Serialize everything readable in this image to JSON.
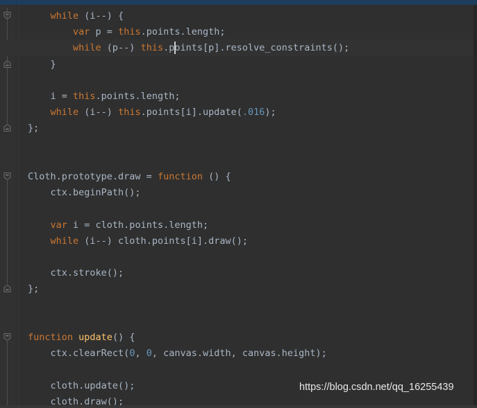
{
  "window": {
    "theme_background": "#2f2f2f",
    "gutter_background": "#313131",
    "titlebar_color": "#1e3d5c",
    "current_line_color": "#323232",
    "keyword_color": "#cc7832",
    "function_color": "#ffc66d",
    "number_color": "#6897bb",
    "text_color": "#a9b7c6",
    "caret_color": "#d0d0d0"
  },
  "watermark": {
    "text": "https://blog.csdn.net/qq_16255439"
  },
  "editor": {
    "language": "JavaScript",
    "caret": {
      "line": 3,
      "column": 26
    },
    "lines": [
      {
        "n": 1,
        "indent": 1,
        "current": false,
        "fold": "start",
        "tokens": [
          {
            "t": "while",
            "c": "kw"
          },
          {
            "t": " (i--) {",
            "c": "plain"
          }
        ]
      },
      {
        "n": 2,
        "indent": 2,
        "current": false,
        "fold": "none",
        "tokens": [
          {
            "t": "var",
            "c": "kw"
          },
          {
            "t": " p = ",
            "c": "plain"
          },
          {
            "t": "this",
            "c": "kw"
          },
          {
            "t": ".points.length;",
            "c": "plain"
          }
        ]
      },
      {
        "n": 3,
        "indent": 2,
        "current": true,
        "fold": "none",
        "tokens": [
          {
            "t": "while",
            "c": "kw"
          },
          {
            "t": " (p--) ",
            "c": "plain"
          },
          {
            "t": "this",
            "c": "kw"
          },
          {
            "t": ".points[p].resolve_constraints();",
            "c": "plain"
          }
        ]
      },
      {
        "n": 4,
        "indent": 1,
        "current": false,
        "fold": "end",
        "tokens": [
          {
            "t": "}",
            "c": "plain"
          }
        ]
      },
      {
        "n": 5,
        "indent": 0,
        "current": false,
        "fold": "none",
        "tokens": []
      },
      {
        "n": 6,
        "indent": 1,
        "current": false,
        "fold": "none",
        "tokens": [
          {
            "t": "i = ",
            "c": "plain"
          },
          {
            "t": "this",
            "c": "kw"
          },
          {
            "t": ".points.length;",
            "c": "plain"
          }
        ]
      },
      {
        "n": 7,
        "indent": 1,
        "current": false,
        "fold": "none",
        "tokens": [
          {
            "t": "while",
            "c": "kw"
          },
          {
            "t": " (i--) ",
            "c": "plain"
          },
          {
            "t": "this",
            "c": "kw"
          },
          {
            "t": ".points[i].update(",
            "c": "plain"
          },
          {
            "t": ".016",
            "c": "num"
          },
          {
            "t": ");",
            "c": "plain"
          }
        ]
      },
      {
        "n": 8,
        "indent": 0,
        "current": false,
        "fold": "end",
        "tokens": [
          {
            "t": "};",
            "c": "plain"
          }
        ]
      },
      {
        "n": 9,
        "indent": 0,
        "current": false,
        "fold": "none",
        "tokens": []
      },
      {
        "n": 10,
        "indent": 0,
        "current": false,
        "fold": "none",
        "tokens": []
      },
      {
        "n": 11,
        "indent": 0,
        "current": false,
        "fold": "start",
        "tokens": [
          {
            "t": "Cloth.prototype.draw = ",
            "c": "plain"
          },
          {
            "t": "function",
            "c": "kw"
          },
          {
            "t": " () {",
            "c": "plain"
          }
        ]
      },
      {
        "n": 12,
        "indent": 1,
        "current": false,
        "fold": "none",
        "tokens": [
          {
            "t": "ctx.beginPath();",
            "c": "plain"
          }
        ]
      },
      {
        "n": 13,
        "indent": 0,
        "current": false,
        "fold": "none",
        "tokens": []
      },
      {
        "n": 14,
        "indent": 1,
        "current": false,
        "fold": "none",
        "tokens": [
          {
            "t": "var",
            "c": "kw"
          },
          {
            "t": " i = cloth.points.length;",
            "c": "plain"
          }
        ]
      },
      {
        "n": 15,
        "indent": 1,
        "current": false,
        "fold": "none",
        "tokens": [
          {
            "t": "while",
            "c": "kw"
          },
          {
            "t": " (i--) cloth.points[i].draw();",
            "c": "plain"
          }
        ]
      },
      {
        "n": 16,
        "indent": 0,
        "current": false,
        "fold": "none",
        "tokens": []
      },
      {
        "n": 17,
        "indent": 1,
        "current": false,
        "fold": "none",
        "tokens": [
          {
            "t": "ctx.stroke();",
            "c": "plain"
          }
        ]
      },
      {
        "n": 18,
        "indent": 0,
        "current": false,
        "fold": "end",
        "tokens": [
          {
            "t": "};",
            "c": "plain"
          }
        ]
      },
      {
        "n": 19,
        "indent": 0,
        "current": false,
        "fold": "none",
        "tokens": []
      },
      {
        "n": 20,
        "indent": 0,
        "current": false,
        "fold": "none",
        "tokens": []
      },
      {
        "n": 21,
        "indent": 0,
        "current": false,
        "fold": "start",
        "tokens": [
          {
            "t": "function",
            "c": "kw"
          },
          {
            "t": " ",
            "c": "plain"
          },
          {
            "t": "update",
            "c": "fn"
          },
          {
            "t": "() {",
            "c": "plain"
          }
        ]
      },
      {
        "n": 22,
        "indent": 1,
        "current": false,
        "fold": "none",
        "tokens": [
          {
            "t": "ctx.clearRect(",
            "c": "plain"
          },
          {
            "t": "0",
            "c": "num"
          },
          {
            "t": ", ",
            "c": "plain"
          },
          {
            "t": "0",
            "c": "num"
          },
          {
            "t": ", canvas.width, canvas.height);",
            "c": "plain"
          }
        ]
      },
      {
        "n": 23,
        "indent": 0,
        "current": false,
        "fold": "none",
        "tokens": []
      },
      {
        "n": 24,
        "indent": 1,
        "current": false,
        "fold": "none",
        "tokens": [
          {
            "t": "cloth.update();",
            "c": "plain"
          }
        ]
      },
      {
        "n": 25,
        "indent": 1,
        "current": false,
        "fold": "none",
        "tokens": [
          {
            "t": "cloth.draw();",
            "c": "plain"
          }
        ]
      }
    ]
  }
}
